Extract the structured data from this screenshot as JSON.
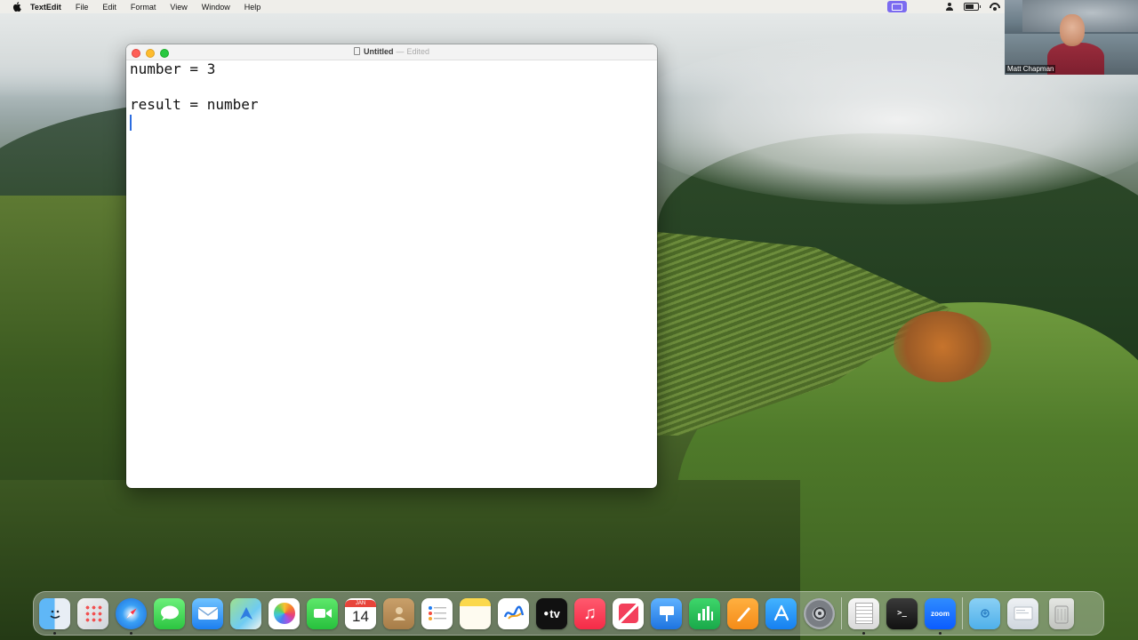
{
  "menubar": {
    "apple_icon": "apple-logo",
    "app_name": "TextEdit",
    "menus": [
      "File",
      "Edit",
      "Format",
      "View",
      "Window",
      "Help"
    ],
    "status_icons": [
      "screen-share-icon",
      "user-icon",
      "battery-icon",
      "wifi-icon"
    ]
  },
  "video": {
    "participant_name": "Matt Chapman"
  },
  "window": {
    "title": "Untitled",
    "separator": "—",
    "status": "Edited",
    "lines": [
      "number = 3",
      "",
      "result = number"
    ]
  },
  "dock": {
    "calendar_month": "JAN",
    "calendar_day": "14",
    "tv_label": "tv",
    "terminal_label": ">_",
    "zoom_label": "zoom",
    "apps": [
      "Finder",
      "Launchpad",
      "Safari",
      "Messages",
      "Mail",
      "Maps",
      "Photos",
      "FaceTime",
      "Calendar",
      "Contacts",
      "Reminders",
      "Notes",
      "Freeform",
      "TV",
      "Music",
      "News",
      "Keynote",
      "Numbers",
      "Pages",
      "App Store",
      "System Settings",
      "TextEdit",
      "Terminal",
      "Zoom",
      "Folder",
      "Downloads",
      "Trash"
    ]
  },
  "colors": {
    "screen_share": "#7b6bf0",
    "caret": "#2c6de0"
  }
}
